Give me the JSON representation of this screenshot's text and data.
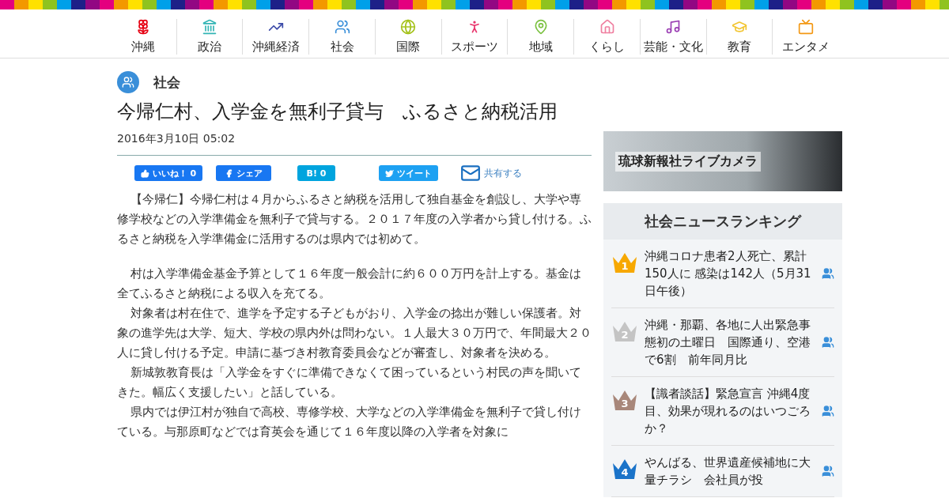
{
  "nav": [
    {
      "label": "沖縄",
      "color": "#e60012"
    },
    {
      "label": "政治",
      "color": "#33b5b5"
    },
    {
      "label": "沖縄経済",
      "color": "#3b4aa8"
    },
    {
      "label": "社会",
      "color": "#3a8fd9"
    },
    {
      "label": "国際",
      "color": "#a5c21c"
    },
    {
      "label": "スポーツ",
      "color": "#e8336b"
    },
    {
      "label": "地域",
      "color": "#7cc242"
    },
    {
      "label": "くらし",
      "color": "#ef7fa0"
    },
    {
      "label": "芸能・文化",
      "color": "#9b3fb4"
    },
    {
      "label": "教育",
      "color": "#f2c531"
    },
    {
      "label": "エンタメ",
      "color": "#f39814"
    }
  ],
  "article": {
    "category": "社会",
    "title": "今帰仁村、入学金を無利子貸与　ふるさと納税活用",
    "date": "2016年3月10日 05:02",
    "share": [
      {
        "kind": "like",
        "label": "いいね！",
        "count": "0"
      },
      {
        "kind": "share",
        "label": "シェア"
      },
      {
        "kind": "hatena",
        "label": "B!",
        "count": "0"
      },
      {
        "kind": "tweet",
        "label": "ツイート"
      },
      {
        "kind": "mail",
        "label": "共有する"
      }
    ],
    "paragraphs": [
      "【今帰仁】今帰仁村は４月からふるさと納税を活用して独自基金を創設し、大学や専修学校などの入学準備金を無利子で貸与する。２０１７年度の入学者から貸し付ける。ふるさと納税を入学準備金に活用するのは県内では初めて。",
      "村は入学準備金基金予算として１６年度一般会計に約６００万円を計上する。基金は全てふるさと納税による収入を充てる。",
      "対象者は村在住で、進学を予定する子どもがおり、入学金の捻出が難しい保護者。対象の進学先は大学、短大、学校の県内外は問わない。１人最大３０万円で、年間最大２０人に貸し付ける予定。申請に基づき村教育委員会などが審査し、対象者を決める。",
      "新城敦教育長は「入学金をすぐに準備できなくて困っているという村民の声を聞いてきた。幅広く支援したい」と話している。",
      "県内では伊江村が独自で高校、専修学校、大学などの入学準備金を無利子で貸し付けている。与那原町などでは育英会を通じて１６年度以降の入学者を対象に"
    ]
  },
  "sidebar": {
    "banner": "琉球新報社ライブカメラ",
    "ranking_title": "社会ニュースランキング",
    "ranking": [
      {
        "rank": "1",
        "color": "#f7a800",
        "title": "沖縄コロナ患者2人死亡、累計150人に 感染は142人（5月31日午後）"
      },
      {
        "rank": "2",
        "color": "#c4c4c4",
        "title": "沖縄・那覇、各地に人出緊急事態初の土曜日　国際通り、空港で6割　前年同月比"
      },
      {
        "rank": "3",
        "color": "#a8877a",
        "title": "【識者談話】緊急宣言 沖縄4度目、効果が現れるのはいつごろか？"
      },
      {
        "rank": "4",
        "color": "#1a73c9",
        "title": "やんばる、世界遺産候補地に大量チラシ　会社員が投"
      }
    ]
  }
}
